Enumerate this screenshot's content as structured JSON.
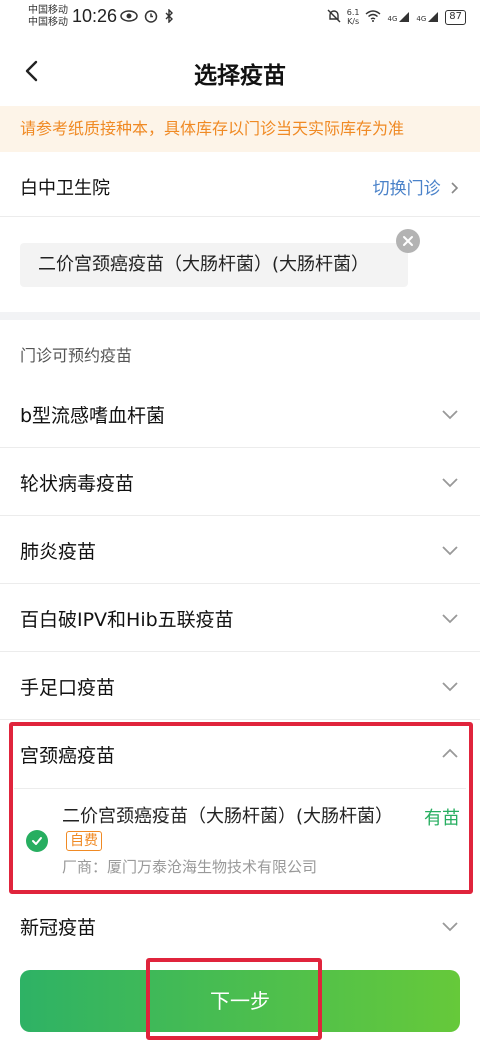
{
  "status_bar": {
    "carrier_1": "中国移动",
    "carrier_2": "中国移动",
    "time": "10:26",
    "net_speed": "6.1",
    "net_speed_unit": "K/s",
    "signal_1": "4G",
    "signal_2": "4G",
    "battery": "87"
  },
  "header": {
    "title": "选择疫苗",
    "back_icon": "back-arrow-icon"
  },
  "notice": "请参考纸质接种本，具体库存以门诊当天实际库存为准",
  "clinic": {
    "name": "白中卫生院",
    "switch_label": "切换门诊",
    "selected_chip": "二价宫颈癌疫苗（大肠杆菌）(大肠杆菌）"
  },
  "vaccines": {
    "section_label": "门诊可预约疫苗",
    "categories": [
      {
        "label": "b型流感嗜血杆菌"
      },
      {
        "label": "轮状病毒疫苗"
      },
      {
        "label": "肺炎疫苗"
      },
      {
        "label": "百白破IPV和Hib五联疫苗"
      },
      {
        "label": "手足口疫苗"
      }
    ],
    "expanded": {
      "label": "宫颈癌疫苗",
      "item": {
        "name": "二价宫颈癌疫苗（大肠杆菌）(大肠杆菌）",
        "tag": "自费",
        "stock": "有苗",
        "manufacturer": "厂商：厦门万泰沧海生物技术有限公司"
      }
    },
    "last_category": {
      "label": "新冠疫苗"
    }
  },
  "footer": {
    "next_label": "下一步"
  },
  "colors": {
    "accent_green": "#27ae60",
    "notice_orange": "#f08a24",
    "link_blue": "#4a82c9",
    "highlight_red": "#e0243c"
  }
}
